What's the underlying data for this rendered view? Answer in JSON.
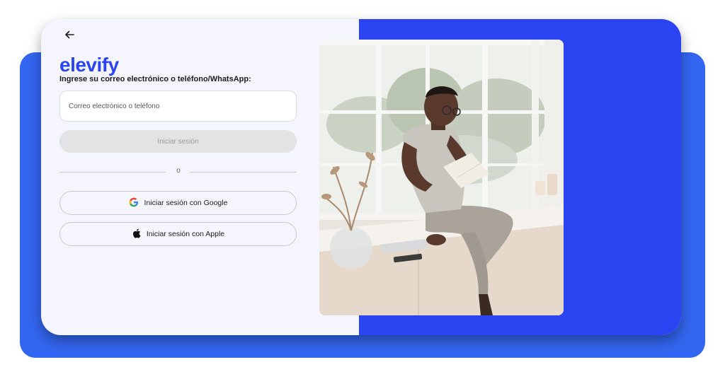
{
  "brand": {
    "logo_text": "elevify",
    "accent_color": "#2b44f2",
    "backdrop_color": "#3366f0"
  },
  "login": {
    "back_icon": "arrow-left-icon",
    "prompt": "Ingrese su correo electrónico o teléfono/WhatsApp:",
    "email_placeholder": "Correo electrónico o teléfono",
    "email_value": "",
    "submit_label": "Iniciar sesión",
    "divider_text": "o",
    "google_label": "Iniciar sesión con Google",
    "google_icon": "google-icon",
    "apple_label": "Iniciar sesión con Apple",
    "apple_icon": "apple-icon"
  },
  "hero": {
    "image": "photo of a man reading a notebook while sitting on a windowsill"
  }
}
